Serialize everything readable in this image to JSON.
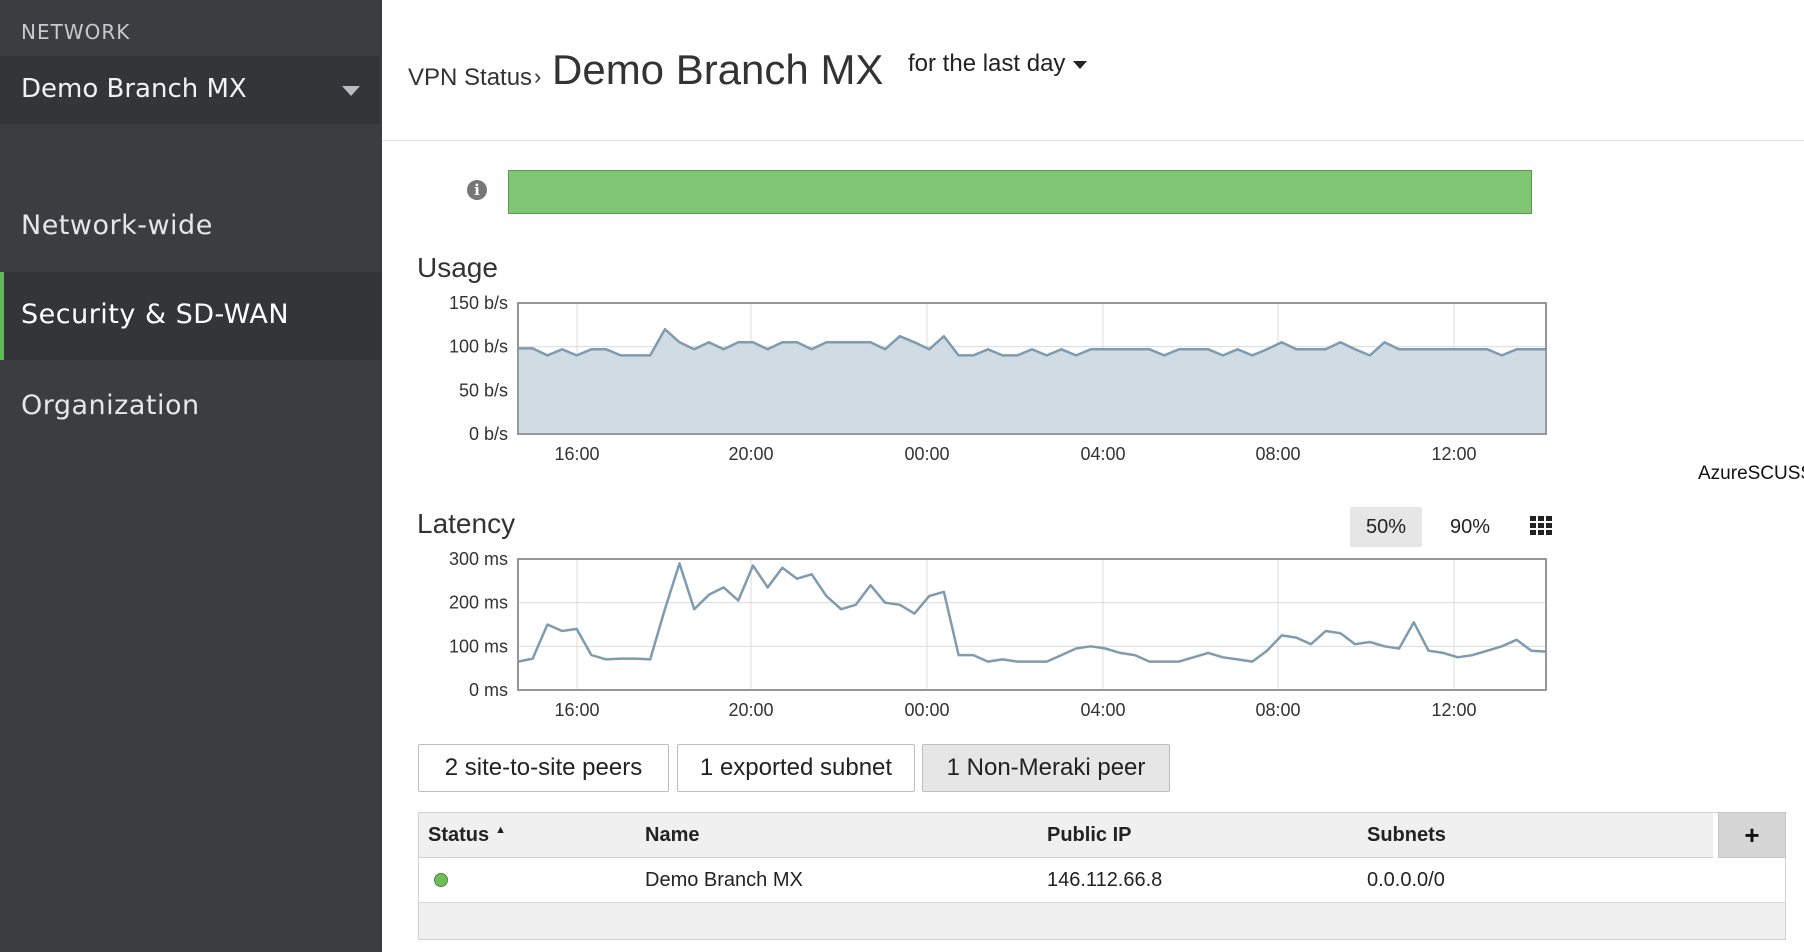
{
  "sidebar": {
    "section_label": "NETWORK",
    "network_name": "Demo Branch MX",
    "items": [
      {
        "label": "Network-wide",
        "active": false
      },
      {
        "label": "Security & SD-WAN",
        "active": true
      },
      {
        "label": "Organization",
        "active": false
      }
    ]
  },
  "header": {
    "breadcrumb": "VPN Status",
    "separator": "›",
    "title": "Demo Branch MX",
    "timespan": "for the last day"
  },
  "status_bar": {
    "color": "#80c675"
  },
  "usage": {
    "title": "Usage",
    "chart_data": {
      "type": "area",
      "title": "Usage",
      "y_ticks": [
        "150 b/s",
        "100 b/s",
        "50 b/s",
        "0 b/s"
      ],
      "ylim": [
        0,
        150
      ],
      "x_ticks": [
        "16:00",
        "20:00",
        "00:00",
        "04:00",
        "08:00",
        "12:00"
      ],
      "values": [
        98,
        98,
        90,
        97,
        90,
        97,
        97,
        90,
        90,
        90,
        120,
        105,
        97,
        105,
        97,
        105,
        105,
        97,
        105,
        105,
        97,
        105,
        105,
        105,
        105,
        97,
        112,
        105,
        97,
        112,
        90,
        90,
        97,
        90,
        90,
        97,
        90,
        97,
        90,
        97,
        97,
        97,
        97,
        97,
        90,
        97,
        97,
        97,
        90,
        97,
        90,
        97,
        105,
        97,
        97,
        97,
        105,
        97,
        90,
        105,
        97,
        97,
        97,
        97,
        97,
        97,
        97,
        90,
        97,
        97,
        97
      ],
      "color": "#7f9bb0",
      "fill": "#d0dbe3",
      "grid": true
    }
  },
  "remote_label": "AzureSCUSS",
  "latency": {
    "title": "Latency",
    "toggles": [
      "50%",
      "90%"
    ],
    "active_toggle": "50%",
    "chart_data": {
      "type": "line",
      "title": "Latency",
      "y_ticks": [
        "300 ms",
        "200 ms",
        "100 ms",
        "0 ms"
      ],
      "ylim": [
        0,
        300
      ],
      "x_ticks": [
        "16:00",
        "20:00",
        "00:00",
        "04:00",
        "08:00",
        "12:00"
      ],
      "values": [
        65,
        72,
        150,
        135,
        140,
        80,
        70,
        72,
        72,
        70,
        185,
        290,
        185,
        218,
        235,
        205,
        285,
        235,
        280,
        255,
        265,
        215,
        185,
        195,
        240,
        200,
        195,
        175,
        215,
        225,
        80,
        80,
        65,
        70,
        65,
        65,
        65,
        80,
        95,
        100,
        95,
        85,
        80,
        65,
        65,
        65,
        75,
        85,
        75,
        70,
        65,
        90,
        125,
        120,
        105,
        135,
        130,
        105,
        110,
        100,
        95,
        155,
        90,
        85,
        75,
        80,
        90,
        100,
        115,
        90,
        88
      ],
      "color": "#7f9bb0",
      "grid": true
    }
  },
  "tabs": [
    {
      "label": "2 site-to-site peers",
      "active": false
    },
    {
      "label": "1 exported subnet",
      "active": false
    },
    {
      "label": "1 Non-Meraki peer",
      "active": true
    }
  ],
  "table": {
    "columns": [
      "Status",
      "Name",
      "Public IP",
      "Subnets"
    ],
    "sort_indicator": "▲",
    "add_label": "+",
    "rows": [
      {
        "status": "online",
        "name": "Demo Branch MX",
        "public_ip": "146.112.66.8",
        "subnets": "0.0.0.0/0"
      }
    ]
  }
}
